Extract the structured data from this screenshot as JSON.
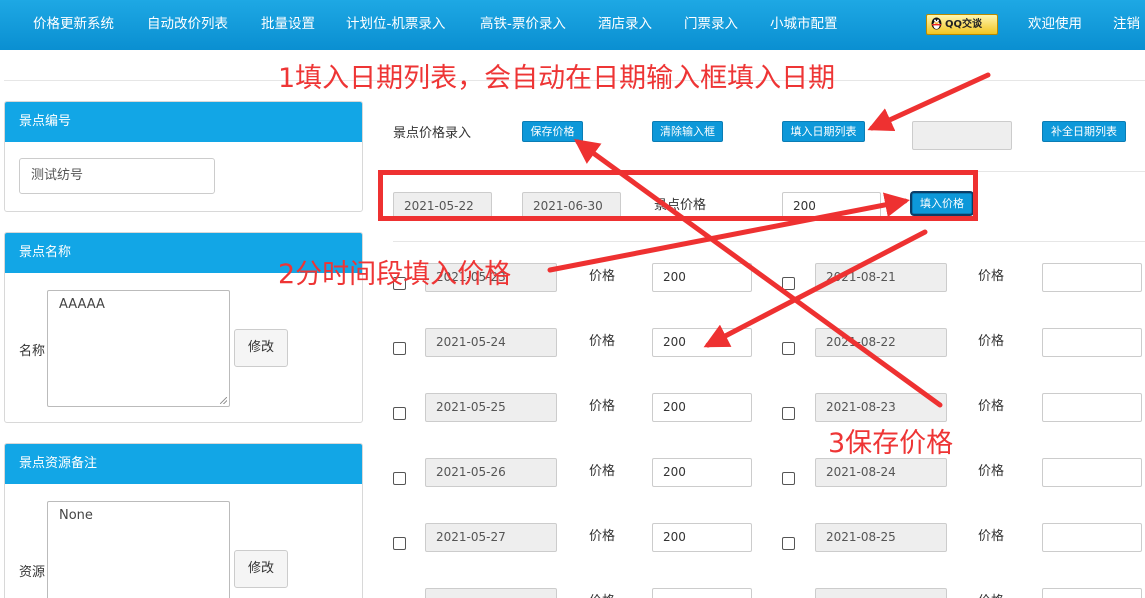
{
  "nav": {
    "items": [
      "价格更新系统",
      "自动改价列表",
      "批量设置",
      "计划位-机票录入",
      "高铁-票价录入",
      "酒店录入",
      "门票录入",
      "小城市配置"
    ],
    "qq_label": "QQ交谈",
    "welcome": "欢迎使用",
    "logout": "注销"
  },
  "spot_number": {
    "title": "景点编号",
    "value": "测试纺号"
  },
  "spot_name": {
    "title": "景点名称",
    "label": "名称",
    "value": "AAAAA",
    "modify": "修改"
  },
  "spot_note": {
    "title": "景点资源备注",
    "label": "资源",
    "value": "None",
    "modify": "修改"
  },
  "toolbar": {
    "label": "景点价格录入",
    "save": "保存价格",
    "clear": "清除输入框",
    "fill_dates": "填入日期列表",
    "fill_dates_value": "",
    "complete_dates": "补全日期列表"
  },
  "range": {
    "start": "2021-05-22",
    "end": "2021-06-30",
    "price_label": "景点价格",
    "price": "200",
    "fill_price": "填入价格"
  },
  "price_label": "价格",
  "rows": [
    {
      "left_date": "2021-05-23",
      "left_price": "200",
      "right_date": "2021-08-21",
      "right_price": ""
    },
    {
      "left_date": "2021-05-24",
      "left_price": "200",
      "right_date": "2021-08-22",
      "right_price": ""
    },
    {
      "left_date": "2021-05-25",
      "left_price": "200",
      "right_date": "2021-08-23",
      "right_price": ""
    },
    {
      "left_date": "2021-05-26",
      "left_price": "200",
      "right_date": "2021-08-24",
      "right_price": ""
    },
    {
      "left_date": "2021-05-27",
      "left_price": "200",
      "right_date": "2021-08-25",
      "right_price": ""
    },
    {
      "left_date": "",
      "left_price": "",
      "right_date": "",
      "right_price": ""
    }
  ],
  "annotations": {
    "step1": "1填入日期列表，会自动在日期输入框填入日期",
    "step2": "2分时间段填入价格",
    "step3": "3保存价格"
  },
  "colors": {
    "nav_bg": "#0a8fd1",
    "panel_head": "#12a6e6",
    "button_blue": "#0d98d9",
    "annotation_red": "#ee3131"
  }
}
